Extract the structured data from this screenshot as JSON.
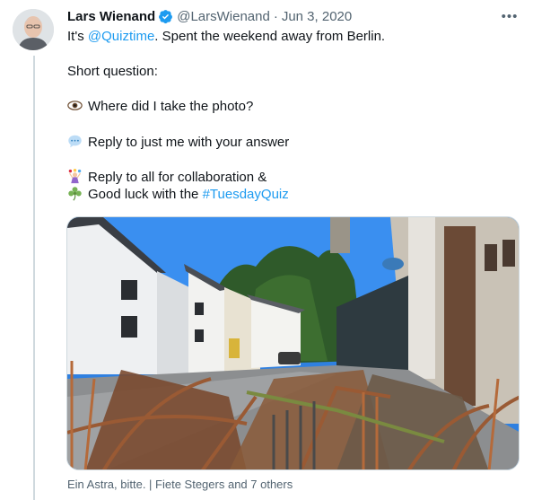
{
  "tweet": {
    "author_name": "Lars Wienand",
    "author_handle": "@LarsWienand",
    "separator": "·",
    "date": "Jun 3, 2020",
    "more_label": "•••",
    "line1_prefix": "It's ",
    "mention": "@Quiztime",
    "line1_suffix": ". Spent the weekend away from Berlin.",
    "line2": "Short question:",
    "line3": "Where did I take the photo?",
    "line4": "Reply to just me with your answer",
    "line5": "Reply to all for collaboration &",
    "line6_prefix": "Good luck with the ",
    "hashtag": "#TuesdayQuiz",
    "media_caption": "Ein Astra, bitte. | Fiete Stegers and 7 others"
  },
  "icons": {
    "verified": "verified-badge-icon",
    "eye": "eye-icon",
    "speech": "speech-bubble-icon",
    "juggler": "juggler-icon",
    "clover": "clover-icon"
  },
  "colors": {
    "link": "#1d9bf0",
    "secondary": "#536471",
    "verified": "#1d9bf0"
  }
}
